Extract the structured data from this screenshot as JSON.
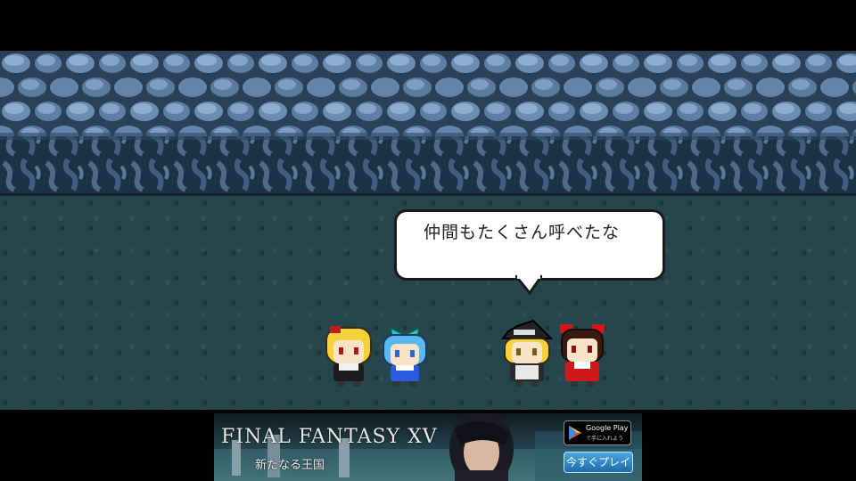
{
  "dialogue": {
    "text": "仲間もたくさん呼べたな"
  },
  "characters": [
    "rumia",
    "cirno",
    "marisa",
    "reimu"
  ],
  "ad": {
    "title": "FINAL FANTASY XV",
    "subtitle": "新たなる王国",
    "store_label": "Google Play",
    "store_sublabel": "で手に入れよう",
    "cta": "今すぐプレイ"
  },
  "colors": {
    "wall": "#3e5a7a",
    "floor": "#25464c",
    "letterbox": "#000000"
  }
}
